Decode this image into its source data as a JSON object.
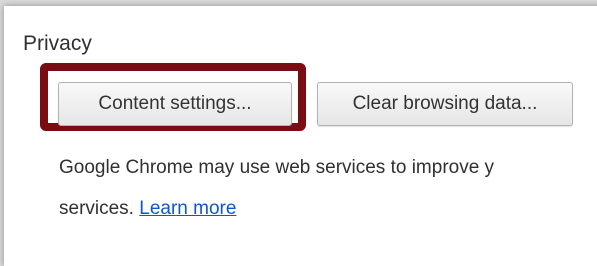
{
  "privacy": {
    "title": "Privacy",
    "content_settings_label": "Content settings...",
    "clear_browsing_data_label": "Clear browsing data...",
    "description_line1": "Google Chrome may use web services to improve y",
    "description_line2_prefix": "services.",
    "learn_more_label": "Learn more"
  },
  "colors": {
    "highlight": "#7a0c14",
    "link": "#1155cc"
  }
}
